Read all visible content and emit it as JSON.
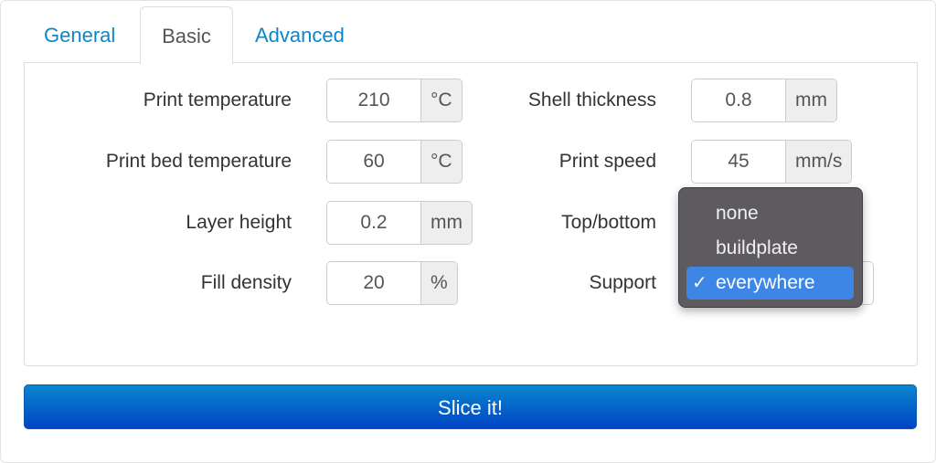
{
  "tabs": [
    {
      "label": "General",
      "active": false
    },
    {
      "label": "Basic",
      "active": true
    },
    {
      "label": "Advanced",
      "active": false
    }
  ],
  "fields_left": [
    {
      "label": "Print temperature",
      "value": "210",
      "unit": "°C"
    },
    {
      "label": "Print bed temperature",
      "value": "60",
      "unit": "°C"
    },
    {
      "label": "Layer height",
      "value": "0.2",
      "unit": "mm"
    },
    {
      "label": "Fill density",
      "value": "20",
      "unit": "%"
    }
  ],
  "fields_right": [
    {
      "label": "Shell thickness",
      "value": "0.8",
      "unit": "mm"
    },
    {
      "label": "Print speed",
      "value": "45",
      "unit": "mm/s"
    },
    {
      "label": "Top/bottom"
    },
    {
      "label": "Support"
    }
  ],
  "support_dropdown": {
    "options": [
      "none",
      "buildplate",
      "everywhere"
    ],
    "selected": "everywhere",
    "check_glyph": "✓"
  },
  "slice_button": "Slice it!"
}
